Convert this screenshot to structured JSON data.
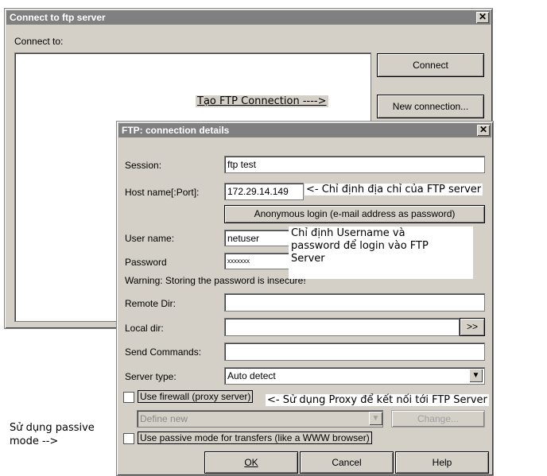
{
  "outer_window": {
    "title": "Connect to ftp server",
    "connect_to_label": "Connect to:",
    "connect_button": "Connect",
    "new_connection_button": "New connection..."
  },
  "annotations": {
    "create_connection": "Tạo FTP Connection ---->",
    "host_hint": "<- Chỉ định địa chỉ của FTP server",
    "user_hint_line1": "Chỉ định Username và",
    "user_hint_line2": "password để login vào FTP",
    "user_hint_line3": "Server",
    "proxy_hint": "<- Sử dụng Proxy để kết nối tới FTP Server",
    "passive_hint_line1": "Sử dụng passive",
    "passive_hint_line2": "mode -->"
  },
  "dialog": {
    "title": "FTP: connection details",
    "session_label": "Session:",
    "session_value": "ftp test",
    "host_label": "Host name[:Port]:",
    "host_value": "172.29.14.149",
    "anonymous_button": "Anonymous login (e-mail address as password)",
    "username_label": "User name:",
    "username_value": "netuser",
    "password_label": "Password",
    "password_value": "xxxxxxx",
    "warning": "Warning: Storing the password is insecure!",
    "remote_dir_label": "Remote Dir:",
    "remote_dir_value": "",
    "local_dir_label": "Local dir:",
    "local_dir_value": "",
    "browse_button": ">>",
    "send_commands_label": "Send Commands:",
    "send_commands_value": "",
    "server_type_label": "Server type:",
    "server_type_value": "Auto detect",
    "use_firewall_label": "Use firewall (proxy server)",
    "firewall_select_value": "Define new",
    "change_button": "Change...",
    "passive_label": "Use passive mode for transfers (like a WWW browser)",
    "ok_button": "OK",
    "cancel_button": "Cancel",
    "help_button": "Help"
  }
}
